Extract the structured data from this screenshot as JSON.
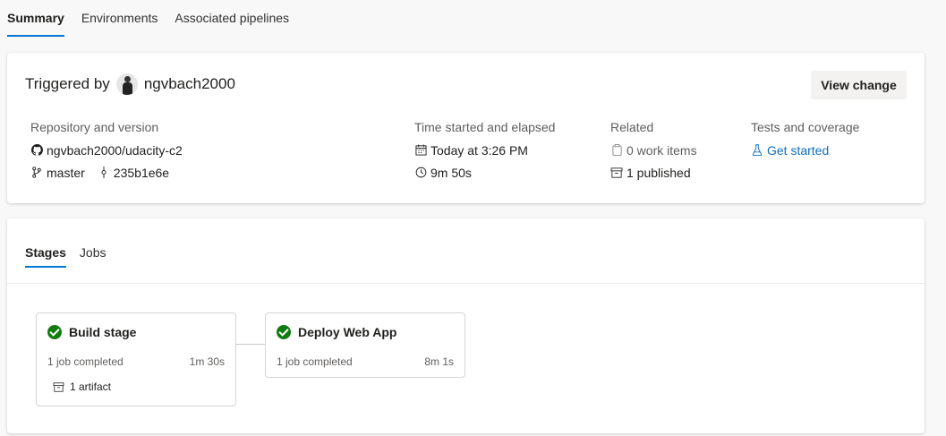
{
  "top_tabs": [
    {
      "label": "Summary",
      "active": true
    },
    {
      "label": "Environments",
      "active": false
    },
    {
      "label": "Associated pipelines",
      "active": false
    }
  ],
  "summary": {
    "triggered_by_label": "Triggered by",
    "user": "ngvbach2000",
    "view_change_label": "View change",
    "repository": {
      "header": "Repository and version",
      "repo": "ngvbach2000/udacity-c2",
      "branch": "master",
      "commit": "235b1e6e"
    },
    "time": {
      "header": "Time started and elapsed",
      "started": "Today at 3:26 PM",
      "elapsed": "9m 50s"
    },
    "related": {
      "header": "Related",
      "work_items": "0 work items",
      "published": "1 published"
    },
    "tests": {
      "header": "Tests and coverage",
      "link": "Get started"
    }
  },
  "stages_panel": {
    "tabs": [
      {
        "label": "Stages",
        "active": true
      },
      {
        "label": "Jobs",
        "active": false
      }
    ],
    "stages": [
      {
        "name": "Build stage",
        "jobs": "1 job completed",
        "duration": "1m 30s",
        "artifact": "1 artifact",
        "status": "succeeded"
      },
      {
        "name": "Deploy Web App",
        "jobs": "1 job completed",
        "duration": "8m 1s",
        "status": "succeeded"
      }
    ]
  },
  "colors": {
    "accent": "#0078d4",
    "success": "#107c10",
    "link": "#106ebe"
  }
}
